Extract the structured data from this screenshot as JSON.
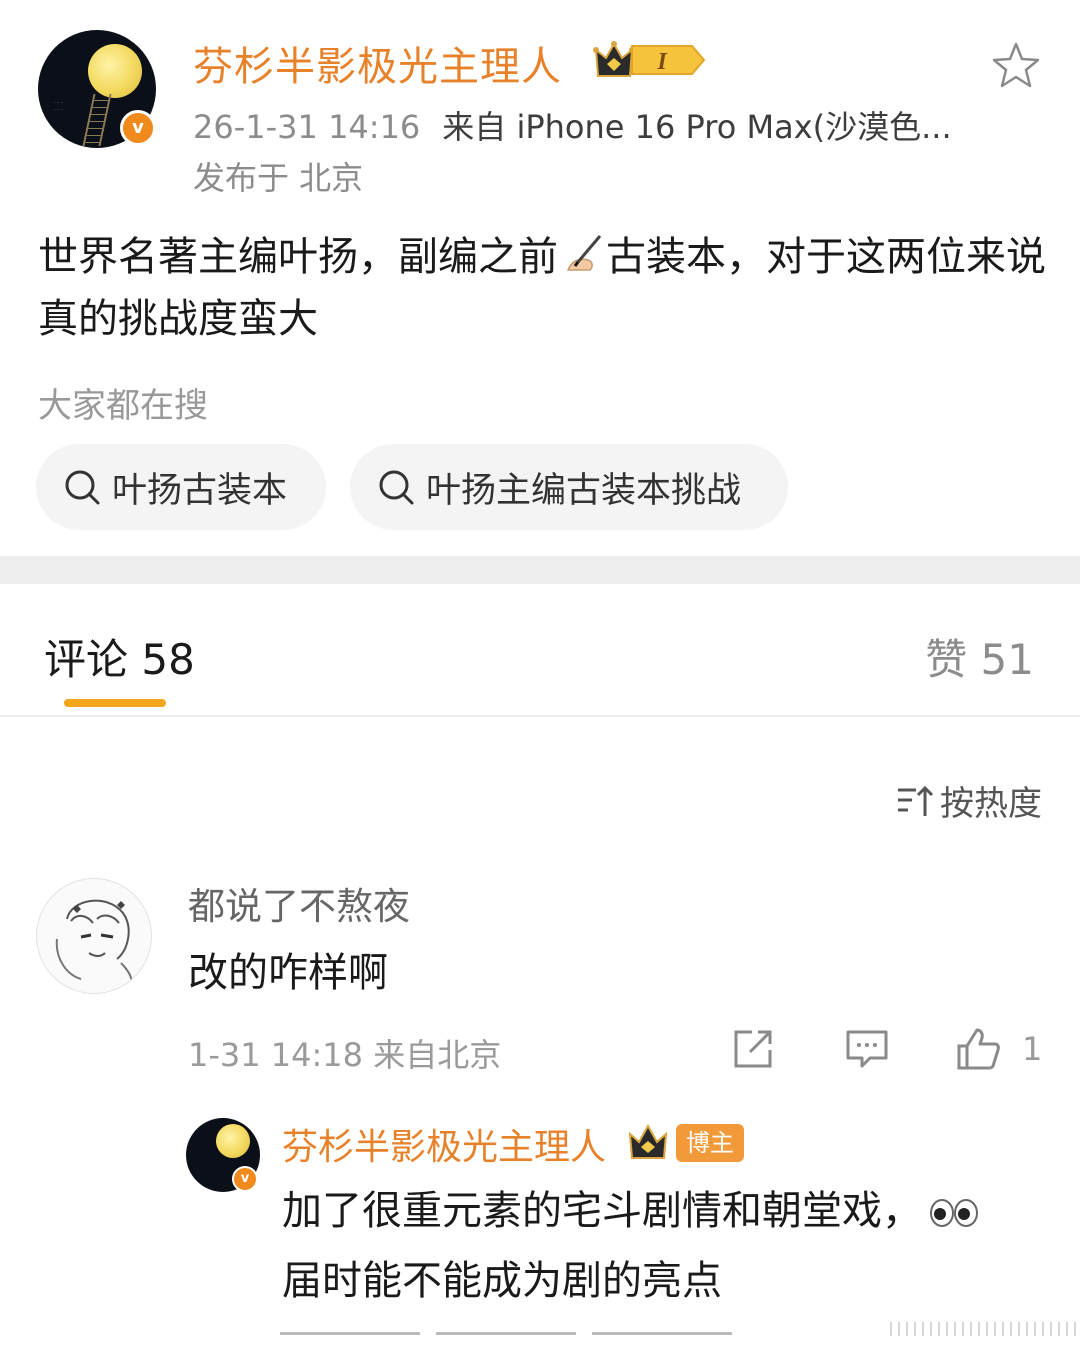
{
  "post": {
    "author_name": "芬杉半影极光主理人",
    "level_badge": "I",
    "timestamp": "26-1-31 14:16",
    "source": "来自 iPhone 16 Pro Max(沙漠色...",
    "location": "发布于 北京",
    "text_part1": "世界名著主编叶扬，副编之前",
    "text_emoji": "writing-hand",
    "text_part2": "古装本，对于这两位来说真的挑战度蛮大"
  },
  "search": {
    "title": "大家都在搜",
    "chips": [
      "叶扬古装本",
      "叶扬主编古装本挑战"
    ]
  },
  "tabs": {
    "comments_label": "评论 58",
    "likes_label": "赞 51"
  },
  "sort": {
    "label": "按热度"
  },
  "comments": [
    {
      "line1": "都说了不熬夜",
      "line2": "改的咋样啊",
      "meta": "1-31 14:18 来自北京",
      "like_count": "1",
      "reply": {
        "author_name": "芬杉半影极光主理人",
        "tag": "博主",
        "text": "加了很重元素的宅斗剧情和朝堂戏，",
        "text2": "届时能不能成为剧的亮点"
      }
    }
  ],
  "colors": {
    "accent_orange": "#e8822a",
    "tab_underline": "#f3a51c",
    "verified": "#f08a1c"
  },
  "icons": [
    "star-icon",
    "search-icon",
    "sort-icon",
    "share-icon",
    "comment-icon",
    "like-icon",
    "crown-icon",
    "eyes-icon",
    "writing-hand-icon"
  ]
}
